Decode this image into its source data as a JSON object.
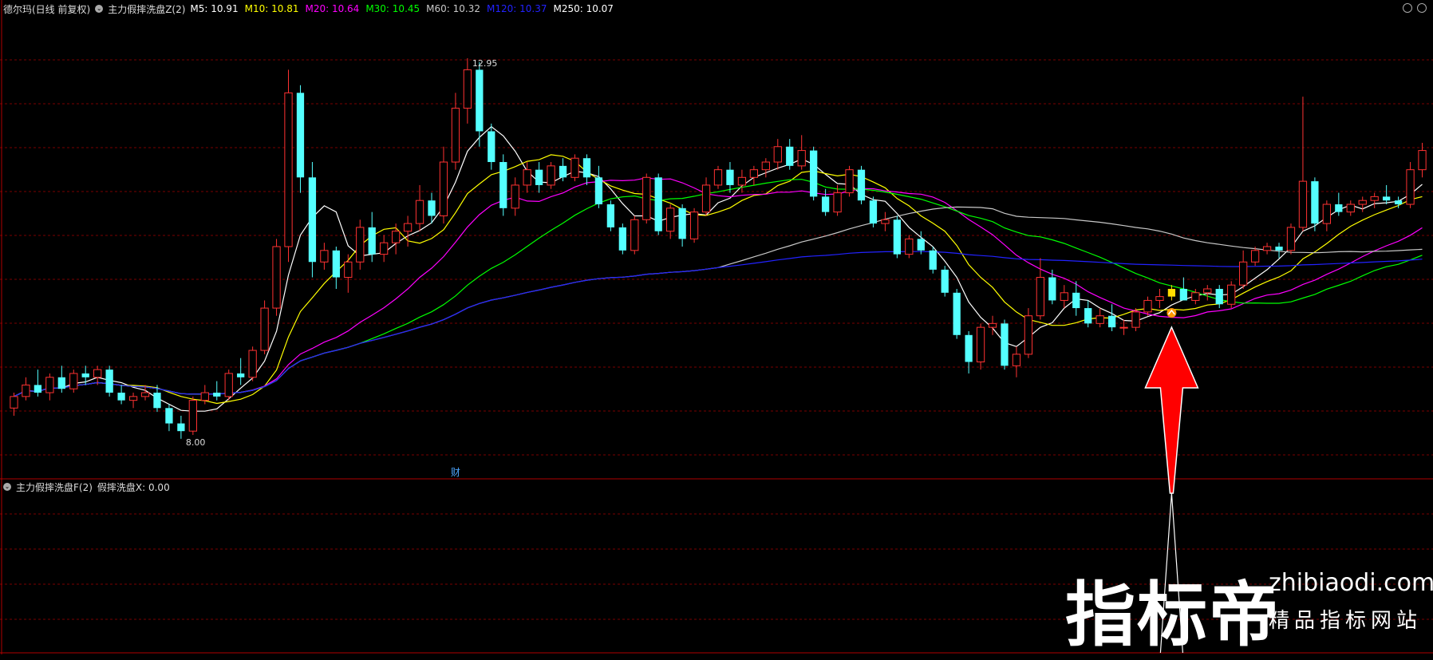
{
  "header": {
    "stock": "德尔玛(日线 前复权)",
    "indicator": "主力假摔洗盘Z(2)",
    "ma": [
      {
        "label": "M5: 10.91",
        "color": "#ffffff"
      },
      {
        "label": "M10: 10.81",
        "color": "#ffff00"
      },
      {
        "label": "M20: 10.64",
        "color": "#ff00ff"
      },
      {
        "label": "M30: 10.45",
        "color": "#00ff00"
      },
      {
        "label": "M60: 10.32",
        "color": "#c8c8c8"
      },
      {
        "label": "M120: 10.37",
        "color": "#2222ff"
      },
      {
        "label": "M250: 10.07",
        "color": "#ffffff"
      }
    ]
  },
  "sub_header": {
    "indicator": "主力假摔洗盘F(2)",
    "value": "假摔洗盘X: 0.00"
  },
  "colors": {
    "up": "#ff3232",
    "down": "#54ffff",
    "grid": "#7a0000",
    "signal": "#ffdd00",
    "arrow": "#ff0000"
  },
  "watermark": {
    "cn": "指标帝",
    "en": "zhibiaodi.com",
    "sub": "精品指标网站"
  },
  "chart_data": [
    {
      "type": "candlestick",
      "title": "德尔玛(日线 前复权)",
      "ylim": [
        7.5,
        13.5
      ],
      "annotations": {
        "high_label": "12.95",
        "low_label": "8.00",
        "event_label": "财"
      },
      "candles": [
        [
          8.4,
          8.6,
          8.3,
          8.55
        ],
        [
          8.55,
          8.8,
          8.5,
          8.7
        ],
        [
          8.7,
          8.9,
          8.55,
          8.6
        ],
        [
          8.6,
          8.85,
          8.5,
          8.8
        ],
        [
          8.8,
          8.95,
          8.6,
          8.65
        ],
        [
          8.65,
          8.9,
          8.6,
          8.85
        ],
        [
          8.85,
          8.95,
          8.7,
          8.8
        ],
        [
          8.8,
          8.95,
          8.7,
          8.9
        ],
        [
          8.9,
          8.95,
          8.55,
          8.6
        ],
        [
          8.6,
          8.7,
          8.45,
          8.5
        ],
        [
          8.5,
          8.6,
          8.4,
          8.55
        ],
        [
          8.55,
          8.7,
          8.5,
          8.6
        ],
        [
          8.6,
          8.7,
          8.35,
          8.4
        ],
        [
          8.4,
          8.45,
          8.1,
          8.2
        ],
        [
          8.2,
          8.3,
          8.0,
          8.1
        ],
        [
          8.1,
          8.55,
          8.05,
          8.5
        ],
        [
          8.5,
          8.7,
          8.45,
          8.6
        ],
        [
          8.6,
          8.75,
          8.5,
          8.55
        ],
        [
          8.55,
          8.9,
          8.5,
          8.85
        ],
        [
          8.85,
          9.05,
          8.7,
          8.8
        ],
        [
          8.8,
          9.2,
          8.75,
          9.15
        ],
        [
          9.15,
          9.8,
          9.1,
          9.7
        ],
        [
          9.7,
          10.6,
          9.6,
          10.5
        ],
        [
          10.5,
          12.8,
          10.3,
          12.5
        ],
        [
          12.5,
          12.6,
          11.2,
          11.4
        ],
        [
          11.4,
          11.6,
          10.1,
          10.3
        ],
        [
          10.3,
          10.55,
          10.2,
          10.45
        ],
        [
          10.45,
          10.5,
          9.95,
          10.1
        ],
        [
          10.1,
          10.4,
          9.9,
          10.3
        ],
        [
          10.3,
          10.85,
          10.2,
          10.75
        ],
        [
          10.75,
          10.95,
          10.3,
          10.4
        ],
        [
          10.4,
          10.65,
          10.3,
          10.55
        ],
        [
          10.55,
          10.8,
          10.4,
          10.7
        ],
        [
          10.7,
          10.9,
          10.5,
          10.8
        ],
        [
          10.8,
          11.3,
          10.7,
          11.1
        ],
        [
          11.1,
          11.2,
          10.8,
          10.9
        ],
        [
          10.9,
          11.8,
          10.8,
          11.6
        ],
        [
          11.6,
          12.5,
          11.5,
          12.3
        ],
        [
          12.3,
          12.95,
          12.1,
          12.8
        ],
        [
          12.8,
          12.9,
          11.8,
          12.0
        ],
        [
          12.0,
          12.1,
          11.5,
          11.6
        ],
        [
          11.6,
          11.7,
          10.9,
          11.0
        ],
        [
          11.0,
          11.4,
          10.9,
          11.3
        ],
        [
          11.3,
          11.6,
          11.2,
          11.5
        ],
        [
          11.5,
          11.6,
          11.2,
          11.3
        ],
        [
          11.3,
          11.6,
          11.25,
          11.55
        ],
        [
          11.55,
          11.65,
          11.35,
          11.4
        ],
        [
          11.4,
          11.7,
          11.35,
          11.65
        ],
        [
          11.65,
          11.7,
          11.3,
          11.4
        ],
        [
          11.4,
          11.55,
          11.0,
          11.05
        ],
        [
          11.05,
          11.1,
          10.7,
          10.75
        ],
        [
          10.75,
          10.8,
          10.4,
          10.45
        ],
        [
          10.45,
          10.9,
          10.4,
          10.85
        ],
        [
          10.85,
          11.45,
          10.8,
          11.4
        ],
        [
          11.4,
          11.45,
          10.65,
          10.7
        ],
        [
          10.7,
          11.05,
          10.6,
          11.0
        ],
        [
          11.0,
          11.05,
          10.5,
          10.6
        ],
        [
          10.6,
          11.0,
          10.55,
          10.95
        ],
        [
          10.95,
          11.4,
          10.9,
          11.3
        ],
        [
          11.3,
          11.55,
          11.25,
          11.5
        ],
        [
          11.5,
          11.6,
          11.2,
          11.3
        ],
        [
          11.3,
          11.5,
          11.2,
          11.4
        ],
        [
          11.4,
          11.55,
          11.3,
          11.5
        ],
        [
          11.5,
          11.65,
          11.4,
          11.6
        ],
        [
          11.6,
          11.9,
          11.5,
          11.8
        ],
        [
          11.8,
          11.9,
          11.5,
          11.55
        ],
        [
          11.55,
          11.95,
          11.5,
          11.75
        ],
        [
          11.75,
          11.8,
          11.1,
          11.15
        ],
        [
          11.15,
          11.25,
          10.9,
          10.95
        ],
        [
          10.95,
          11.3,
          10.9,
          11.2
        ],
        [
          11.2,
          11.55,
          11.15,
          11.5
        ],
        [
          11.5,
          11.55,
          11.05,
          11.1
        ],
        [
          11.1,
          11.15,
          10.75,
          10.8
        ],
        [
          10.8,
          10.95,
          10.7,
          10.85
        ],
        [
          10.85,
          10.9,
          10.35,
          10.4
        ],
        [
          10.4,
          10.65,
          10.35,
          10.6
        ],
        [
          10.6,
          10.7,
          10.4,
          10.45
        ],
        [
          10.45,
          10.5,
          10.15,
          10.2
        ],
        [
          10.2,
          10.25,
          9.85,
          9.9
        ],
        [
          9.9,
          9.95,
          9.3,
          9.35
        ],
        [
          9.35,
          9.4,
          8.85,
          9.0
        ],
        [
          9.0,
          9.5,
          8.9,
          9.45
        ],
        [
          9.45,
          9.6,
          9.35,
          9.5
        ],
        [
          9.5,
          9.55,
          8.9,
          8.95
        ],
        [
          8.95,
          9.2,
          8.8,
          9.1
        ],
        [
          9.1,
          9.7,
          9.05,
          9.6
        ],
        [
          9.6,
          10.35,
          9.55,
          10.1
        ],
        [
          10.1,
          10.2,
          9.75,
          9.8
        ],
        [
          9.8,
          10.0,
          9.7,
          9.9
        ],
        [
          9.9,
          10.05,
          9.6,
          9.7
        ],
        [
          9.7,
          9.8,
          9.45,
          9.5
        ],
        [
          9.5,
          9.7,
          9.45,
          9.6
        ],
        [
          9.6,
          9.75,
          9.4,
          9.45
        ],
        [
          9.45,
          9.55,
          9.35,
          9.45
        ],
        [
          9.45,
          9.7,
          9.4,
          9.65
        ],
        [
          9.65,
          9.85,
          9.6,
          9.8
        ],
        [
          9.8,
          9.95,
          9.7,
          9.85
        ],
        [
          9.85,
          10.0,
          9.8,
          9.95
        ],
        [
          9.95,
          10.1,
          9.85,
          9.8
        ],
        [
          9.8,
          9.95,
          9.75,
          9.9
        ],
        [
          9.9,
          10.0,
          9.8,
          9.95
        ],
        [
          9.95,
          10.0,
          9.7,
          9.75
        ],
        [
          9.75,
          10.05,
          9.7,
          10.0
        ],
        [
          10.0,
          10.45,
          9.95,
          10.3
        ],
        [
          10.3,
          10.5,
          10.25,
          10.45
        ],
        [
          10.45,
          10.55,
          10.4,
          10.5
        ],
        [
          10.5,
          10.55,
          10.35,
          10.45
        ],
        [
          10.45,
          10.8,
          10.4,
          10.75
        ],
        [
          10.75,
          12.45,
          10.7,
          11.35
        ],
        [
          11.35,
          11.4,
          10.7,
          10.8
        ],
        [
          10.8,
          11.1,
          10.7,
          11.05
        ],
        [
          11.05,
          11.2,
          10.9,
          10.95
        ],
        [
          10.95,
          11.1,
          10.9,
          11.05
        ],
        [
          11.05,
          11.15,
          10.95,
          11.1
        ],
        [
          11.1,
          11.2,
          11.0,
          11.15
        ],
        [
          11.15,
          11.3,
          11.05,
          11.1
        ],
        [
          11.1,
          11.15,
          11.0,
          11.05
        ],
        [
          11.05,
          11.6,
          11.0,
          11.5
        ],
        [
          11.5,
          11.85,
          11.4,
          11.75
        ]
      ],
      "signal_bar_index": 97
    },
    {
      "type": "line",
      "title": "主力假摔洗盘F(2)",
      "series": [
        {
          "name": "假摔洗盘X",
          "spike_at_index": 97,
          "value_shown": "0.00"
        }
      ]
    }
  ]
}
